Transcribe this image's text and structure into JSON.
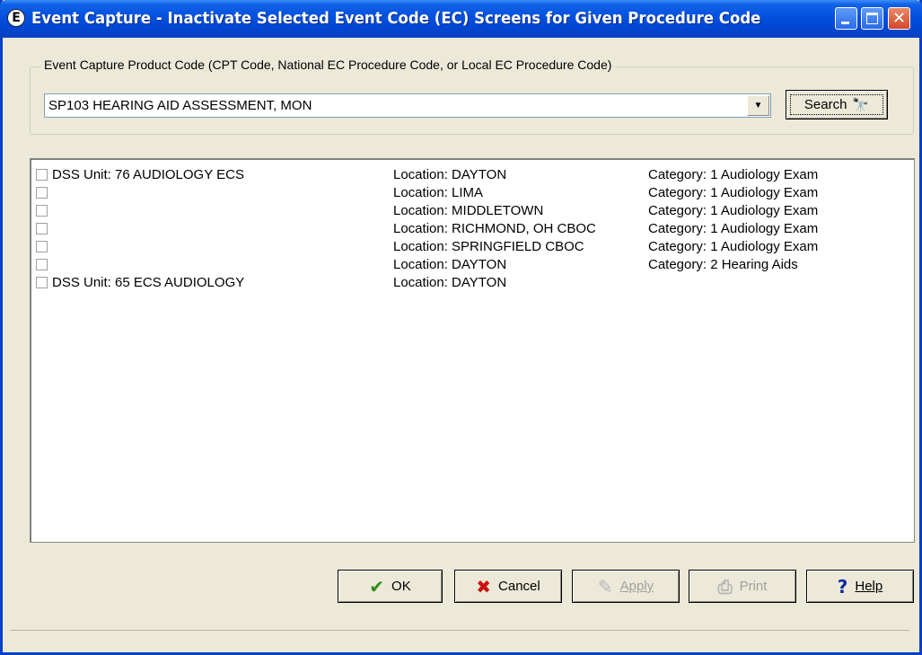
{
  "window": {
    "title": "Event Capture - Inactivate Selected Event Code (EC) Screens for Given Procedure Code",
    "icon_letter": "E"
  },
  "product_code": {
    "label": "Event Capture Product Code (CPT Code, National EC Procedure Code, or Local EC Procedure Code)",
    "value": "SP103  HEARING AID ASSESSMENT, MON",
    "search_label": "Search"
  },
  "rows": [
    {
      "unit": "DSS Unit: 76 AUDIOLOGY ECS",
      "location": "Location: DAYTON",
      "category": "Category: 1 Audiology Exam"
    },
    {
      "unit": "",
      "location": "Location: LIMA",
      "category": "Category: 1 Audiology Exam"
    },
    {
      "unit": "",
      "location": "Location: MIDDLETOWN",
      "category": "Category: 1 Audiology Exam"
    },
    {
      "unit": "",
      "location": "Location: RICHMOND, OH CBOC",
      "category": "Category: 1 Audiology Exam"
    },
    {
      "unit": "",
      "location": "Location: SPRINGFIELD CBOC",
      "category": "Category: 1 Audiology Exam"
    },
    {
      "unit": "",
      "location": "Location: DAYTON",
      "category": "Category: 2 Hearing Aids"
    },
    {
      "unit": "DSS Unit: 65 ECS AUDIOLOGY",
      "location": "Location: DAYTON",
      "category": ""
    }
  ],
  "buttons": {
    "ok": "OK",
    "cancel": "Cancel",
    "apply": "Apply",
    "print": "Print",
    "help": "Help"
  }
}
